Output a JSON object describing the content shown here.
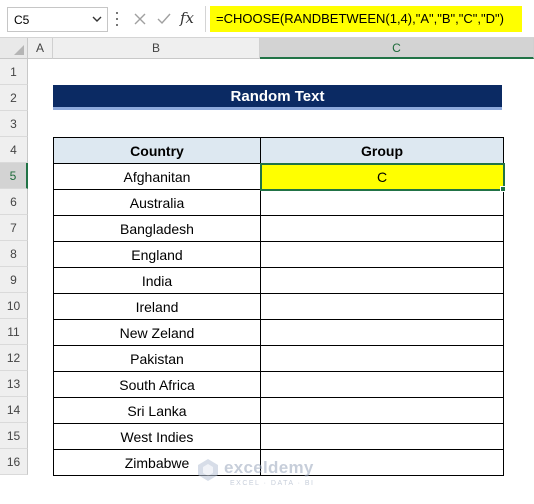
{
  "formula_bar": {
    "name_box": "C5",
    "fx_label": "fx",
    "formula": "=CHOOSE(RANDBETWEEN(1,4),\"A\",\"B\",\"C\",\"D\")"
  },
  "columns": [
    "A",
    "B",
    "C"
  ],
  "rows": [
    "1",
    "2",
    "3",
    "4",
    "5",
    "6",
    "7",
    "8",
    "9",
    "10",
    "11",
    "12",
    "13",
    "14",
    "15",
    "16"
  ],
  "title": "Random Text",
  "table": {
    "headers": [
      "Country",
      "Group"
    ],
    "rows": [
      {
        "country": "Afghanitan",
        "group": "C"
      },
      {
        "country": "Australia",
        "group": ""
      },
      {
        "country": "Bangladesh",
        "group": ""
      },
      {
        "country": "England",
        "group": ""
      },
      {
        "country": "India",
        "group": ""
      },
      {
        "country": "Ireland",
        "group": ""
      },
      {
        "country": "New Zeland",
        "group": ""
      },
      {
        "country": "Pakistan",
        "group": ""
      },
      {
        "country": "South Africa",
        "group": ""
      },
      {
        "country": "Sri Lanka",
        "group": ""
      },
      {
        "country": "West Indies",
        "group": ""
      },
      {
        "country": "Zimbabwe",
        "group": ""
      }
    ]
  },
  "watermark": {
    "brand": "exceldemy",
    "tagline": "EXCEL · DATA · BI"
  },
  "colors": {
    "accent_green": "#217346",
    "highlight": "#ffff00",
    "banner": "#0b2a63",
    "header_fill": "#dde8f1"
  }
}
